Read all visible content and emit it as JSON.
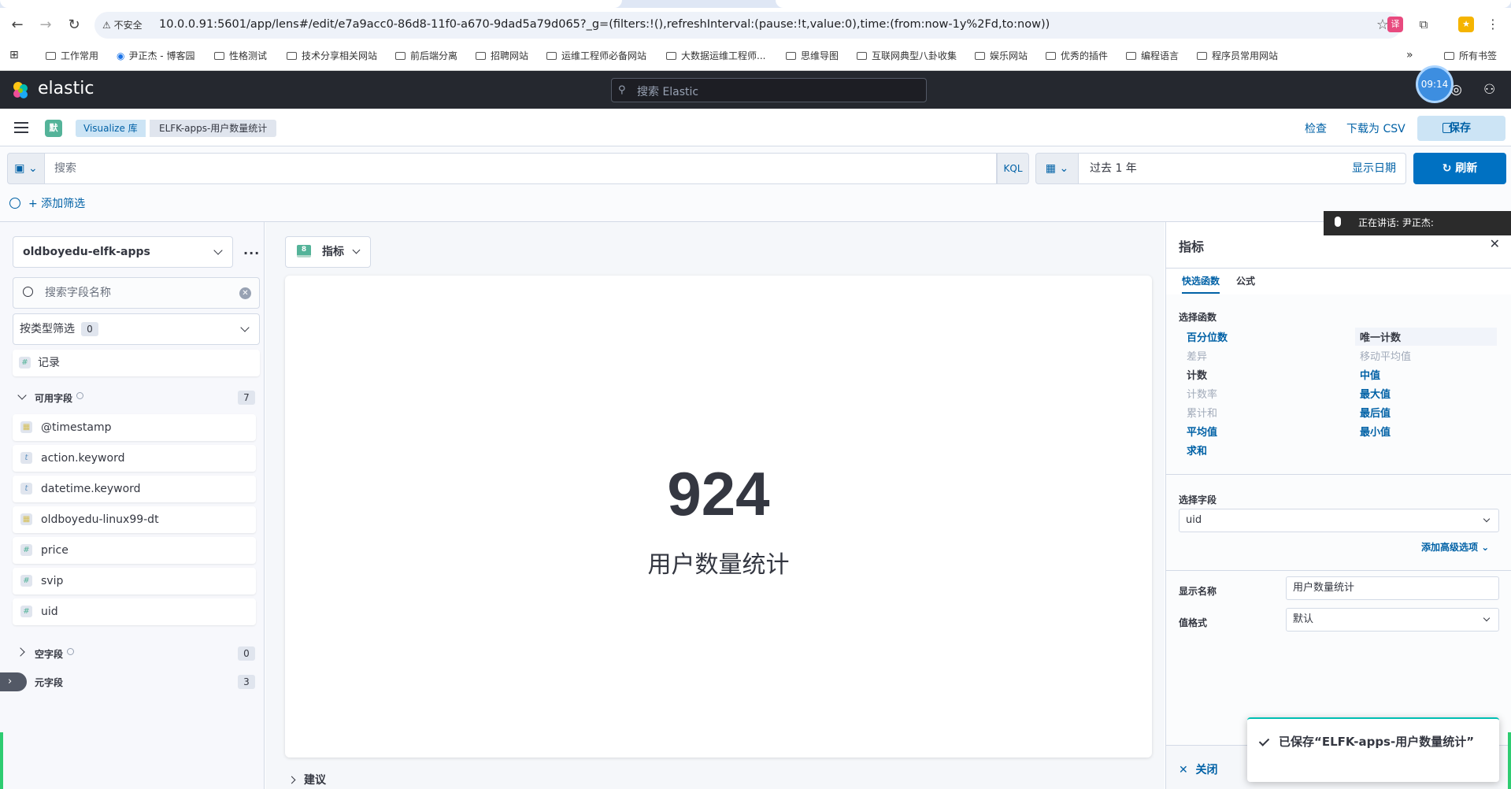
{
  "browser": {
    "security": "不安全",
    "url": "10.0.0.91:5601/app/lens#/edit/e7a9acc0-86d8-11f0-a670-9dad5a79d065?_g=(filters:!(),refreshInterval:(pause:!t,value:0),time:(from:now-1y%2Fd,to:now))",
    "bookmarks": [
      "工作常用",
      "尹正杰 - 博客园",
      "性格测试",
      "技术分享相关网站",
      "前后端分离",
      "招聘网站",
      "运维工程师必备网站",
      "大数据运维工程师...",
      "思维导图",
      "互联网典型八卦收集",
      "娱乐网站",
      "优秀的插件",
      "编程语言",
      "程序员常用网站"
    ],
    "more": "»",
    "all_bookmarks": "所有书签"
  },
  "header": {
    "logo_text": "elastic",
    "search_placeholder": "搜索 Elastic",
    "clock": "09:14"
  },
  "breadcrumb": {
    "space": "默",
    "library": "Visualize 库",
    "current": "ELFK-apps-用户数量统计"
  },
  "top_actions": {
    "inspect": "检查",
    "download": "下载为 CSV",
    "save": "保存"
  },
  "query": {
    "placeholder": "搜索",
    "language": "KQL",
    "time_range": "过去 1 年",
    "show_dates": "显示日期",
    "refresh": "刷新",
    "add_filter": "+ 添加筛选"
  },
  "sidebar": {
    "data_view": "oldboyedu-elfk-apps",
    "field_search_placeholder": "搜索字段名称",
    "type_filter": "按类型筛选",
    "type_filter_count": "0",
    "records": "记录",
    "available_label": "可用字段",
    "available_count": "7",
    "fields": [
      {
        "name": "@timestamp",
        "type": "date"
      },
      {
        "name": "action.keyword",
        "type": "text"
      },
      {
        "name": "datetime.keyword",
        "type": "text"
      },
      {
        "name": "oldboyedu-linux99-dt",
        "type": "date"
      },
      {
        "name": "price",
        "type": "number"
      },
      {
        "name": "svip",
        "type": "number"
      },
      {
        "name": "uid",
        "type": "number"
      }
    ],
    "empty_label": "空字段",
    "empty_count": "0",
    "meta_label": "元字段",
    "meta_count": "3"
  },
  "workspace": {
    "vis_type": "指标",
    "metric_value": "924",
    "metric_label": "用户数量统计",
    "suggestions": "建议"
  },
  "flyout": {
    "title": "指标",
    "tabs": [
      "快选函数",
      "公式"
    ],
    "select_function": "选择函数",
    "functions_left": [
      {
        "label": "百分位数",
        "state": "link"
      },
      {
        "label": "差异",
        "state": "disabled"
      },
      {
        "label": "计数",
        "state": "plain"
      },
      {
        "label": "计数率",
        "state": "disabled"
      },
      {
        "label": "累计和",
        "state": "disabled"
      },
      {
        "label": "平均值",
        "state": "link"
      },
      {
        "label": "求和",
        "state": "link"
      }
    ],
    "functions_right": [
      {
        "label": "唯一计数",
        "state": "selected"
      },
      {
        "label": "移动平均值",
        "state": "disabled"
      },
      {
        "label": "中值",
        "state": "link"
      },
      {
        "label": "最大值",
        "state": "link"
      },
      {
        "label": "最后值",
        "state": "link"
      },
      {
        "label": "最小值",
        "state": "link"
      }
    ],
    "select_field": "选择字段",
    "field_value": "uid",
    "advanced": "添加高级选项",
    "display_name_label": "显示名称",
    "display_name_value": "用户数量统计",
    "value_format_label": "值格式",
    "value_format_value": "默认",
    "close": "关闭"
  },
  "speaking": "正在讲话:  尹正杰:",
  "toast": "已保存“ELFK-apps-用户数量统计”"
}
